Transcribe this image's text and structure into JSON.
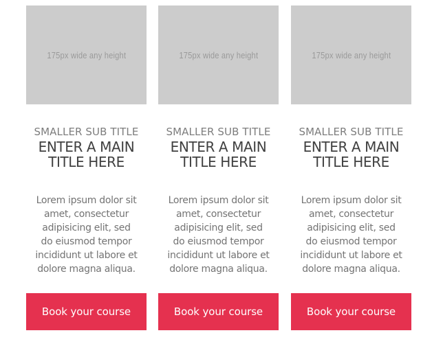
{
  "colors": {
    "placeholder_bg": "#cccccc",
    "placeholder_text": "#9a9a9a",
    "subtitle": "#7d7d7d",
    "title": "#404040",
    "body": "#737373",
    "button_bg": "#e5314f",
    "button_text": "#ffffff"
  },
  "cards": [
    {
      "image_placeholder": "175px wide any height",
      "subtitle": "SMALLER SUB TITLE",
      "title_line1": "ENTER A MAIN",
      "title_line2": "TITLE HERE",
      "body_lines": [
        "Lorem ipsum dolor sit",
        "amet, consectetur",
        "adipisicing elit, sed",
        "do eiusmod tempor",
        "incididunt ut labore et",
        "dolore magna aliqua."
      ],
      "button_label": "Book your course"
    },
    {
      "image_placeholder": "175px wide any height",
      "subtitle": "SMALLER SUB TITLE",
      "title_line1": "ENTER A MAIN",
      "title_line2": "TITLE HERE",
      "body_lines": [
        "Lorem ipsum dolor sit",
        "amet, consectetur",
        "adipisicing elit, sed",
        "do eiusmod tempor",
        "incididunt ut labore et",
        "dolore magna aliqua."
      ],
      "button_label": "Book your course"
    },
    {
      "image_placeholder": "175px wide any height",
      "subtitle": "SMALLER SUB TITLE",
      "title_line1": "ENTER A MAIN",
      "title_line2": "TITLE HERE",
      "body_lines": [
        "Lorem ipsum dolor sit",
        "amet, consectetur",
        "adipisicing elit, sed",
        "do eiusmod tempor",
        "incididunt ut labore et",
        "dolore magna aliqua."
      ],
      "button_label": "Book your course"
    }
  ]
}
